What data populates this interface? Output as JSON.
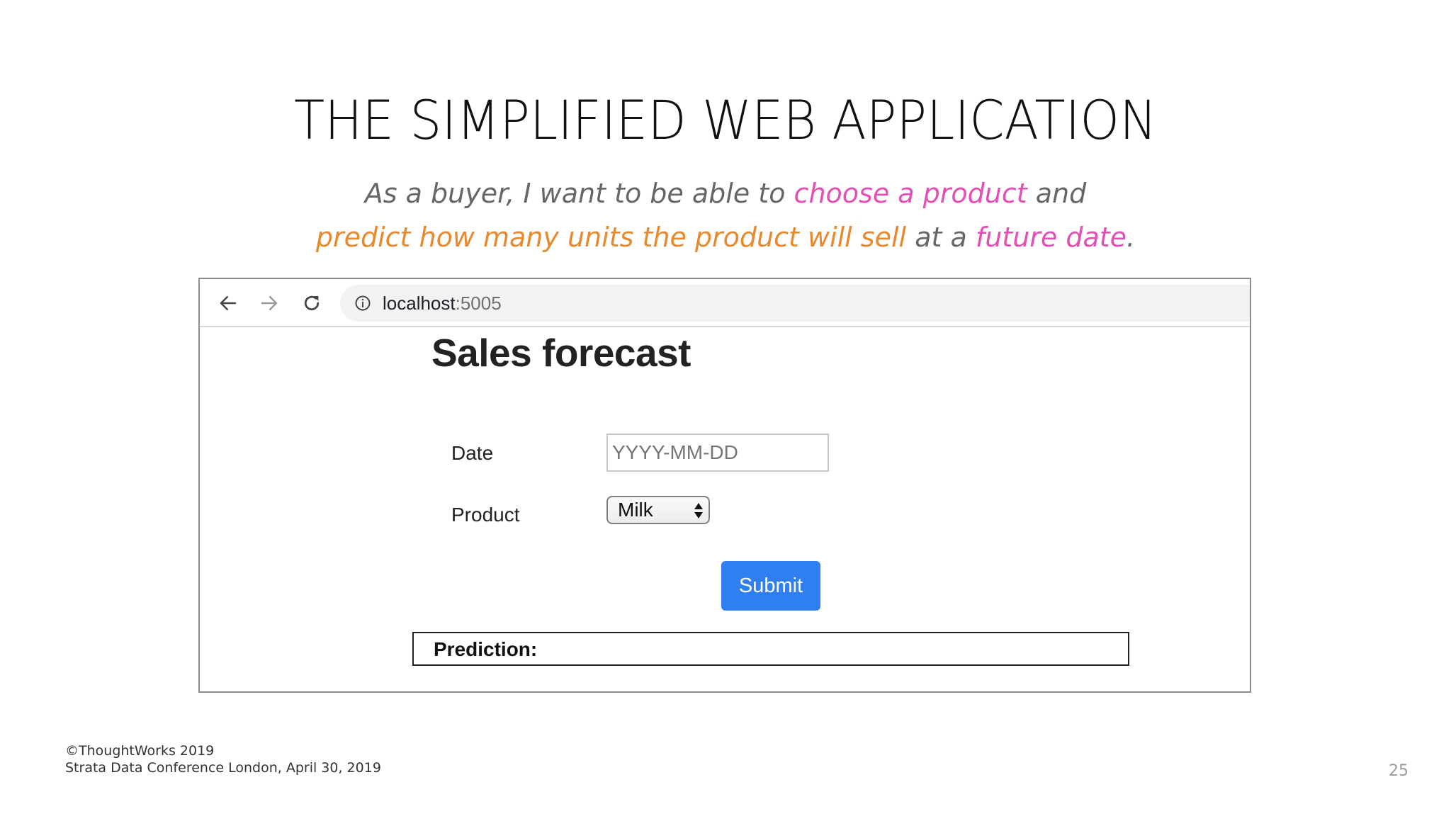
{
  "slide": {
    "title": "THE SIMPLIFIED WEB APPLICATION",
    "subtitle": {
      "line1_part1": "As a buyer, I want to be able to ",
      "line1_highlight": "choose a product",
      "line1_part2": " and",
      "line2_highlight1": "predict how many units the product will sell",
      "line2_part1": " at a ",
      "line2_highlight2": "future date",
      "line2_end": "."
    },
    "colors": {
      "pink": "#e34fb4",
      "orange": "#e8892e",
      "submit_blue": "#2f7ff0"
    },
    "footer": {
      "copyright": "©ThoughtWorks 2019",
      "event": "Strata Data Conference London,  April 30, 2019"
    },
    "page_number": "25"
  },
  "browser": {
    "url_host": "localhost",
    "url_port": ":5005",
    "icons": [
      "arrow-left-icon",
      "arrow-right-icon",
      "reload-icon",
      "info-icon"
    ]
  },
  "app": {
    "heading": "Sales forecast",
    "date_label": "Date",
    "date_placeholder": "YYYY-MM-DD",
    "date_value": "",
    "product_label": "Product",
    "product_selected": "Milk",
    "submit_label": "Submit",
    "prediction_label": "Prediction:"
  }
}
